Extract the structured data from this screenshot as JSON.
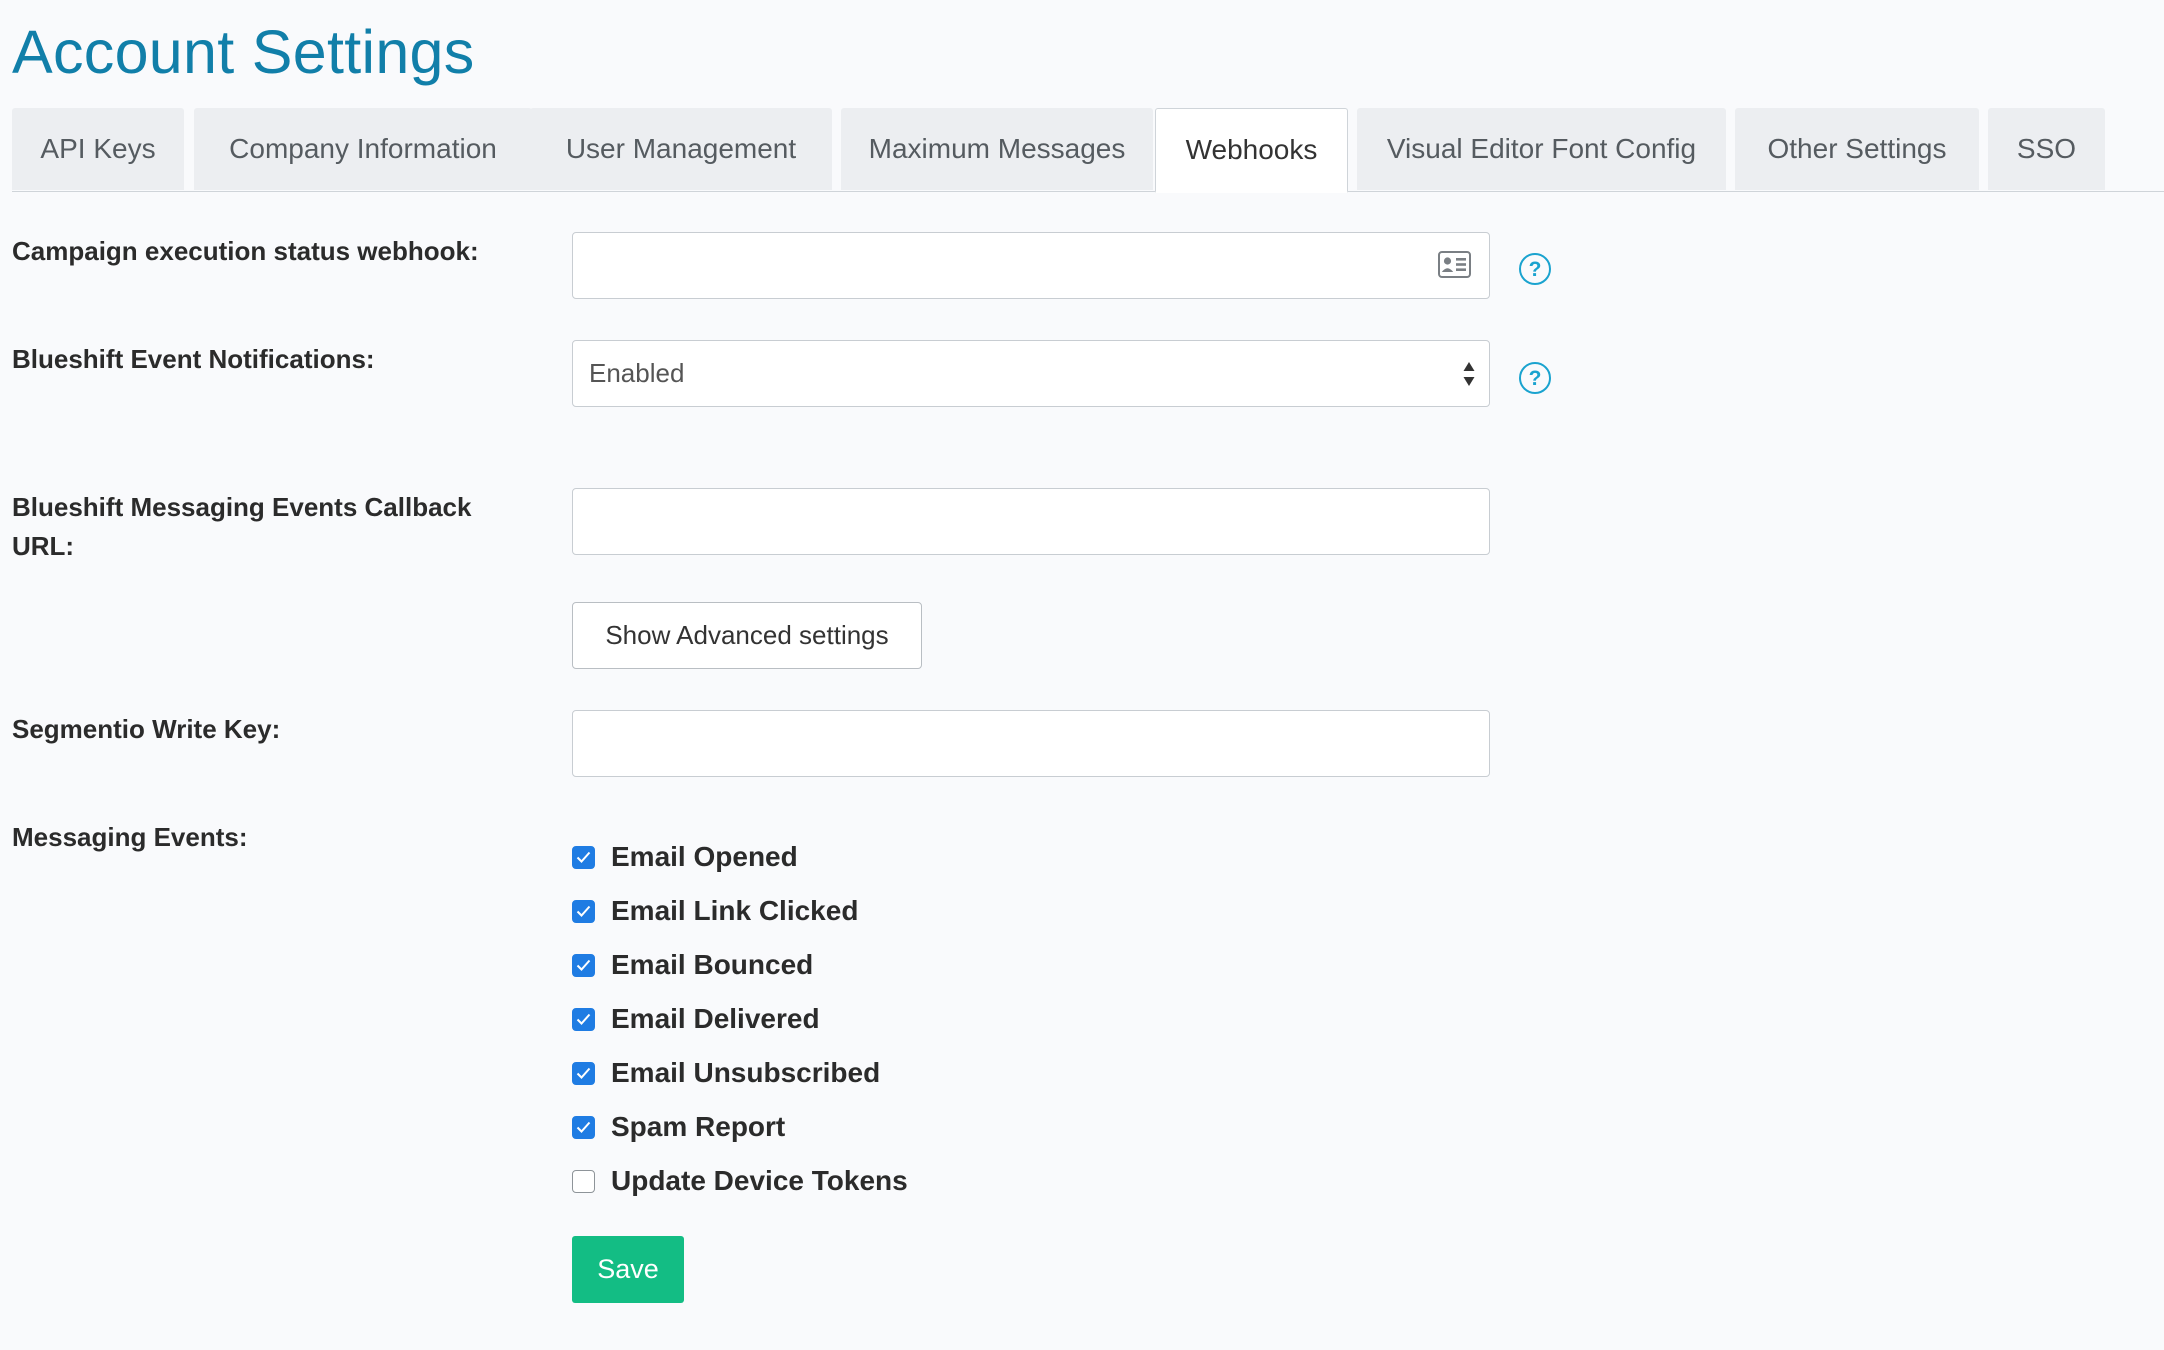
{
  "page": {
    "title": "Account Settings"
  },
  "tabs": [
    {
      "label": "API Keys",
      "active": false
    },
    {
      "label": "Company Information",
      "active": false
    },
    {
      "label": "User Management",
      "active": false
    },
    {
      "label": "Maximum Messages",
      "active": false
    },
    {
      "label": "Webhooks",
      "active": true
    },
    {
      "label": "Visual Editor Font Config",
      "active": false
    },
    {
      "label": "Other Settings",
      "active": false
    },
    {
      "label": "SSO",
      "active": false
    }
  ],
  "form": {
    "campaign_webhook": {
      "label": "Campaign execution status webhook:",
      "value": "",
      "icon": "contact-card-icon"
    },
    "event_notifications": {
      "label": "Blueshift Event Notifications:",
      "selected": "Enabled"
    },
    "callback_url": {
      "label_line1": "Blueshift Messaging Events Callback",
      "label_line2": "URL:",
      "value": ""
    },
    "advanced_button_label": "Show Advanced settings",
    "segment_key": {
      "label": "Segmentio Write Key:",
      "value": ""
    },
    "messaging_events": {
      "label": "Messaging Events:",
      "items": [
        {
          "label": "Email Opened",
          "checked": true
        },
        {
          "label": "Email Link Clicked",
          "checked": true
        },
        {
          "label": "Email Bounced",
          "checked": true
        },
        {
          "label": "Email Delivered",
          "checked": true
        },
        {
          "label": "Email Unsubscribed",
          "checked": true
        },
        {
          "label": "Spam Report",
          "checked": true
        },
        {
          "label": "Update Device Tokens",
          "checked": false
        }
      ]
    },
    "help_glyph": "?",
    "save_label": "Save"
  },
  "colors": {
    "title": "#117fa9",
    "checkbox": "#1f7ce3",
    "save": "#13bd84",
    "help": "#1aa3cf"
  }
}
